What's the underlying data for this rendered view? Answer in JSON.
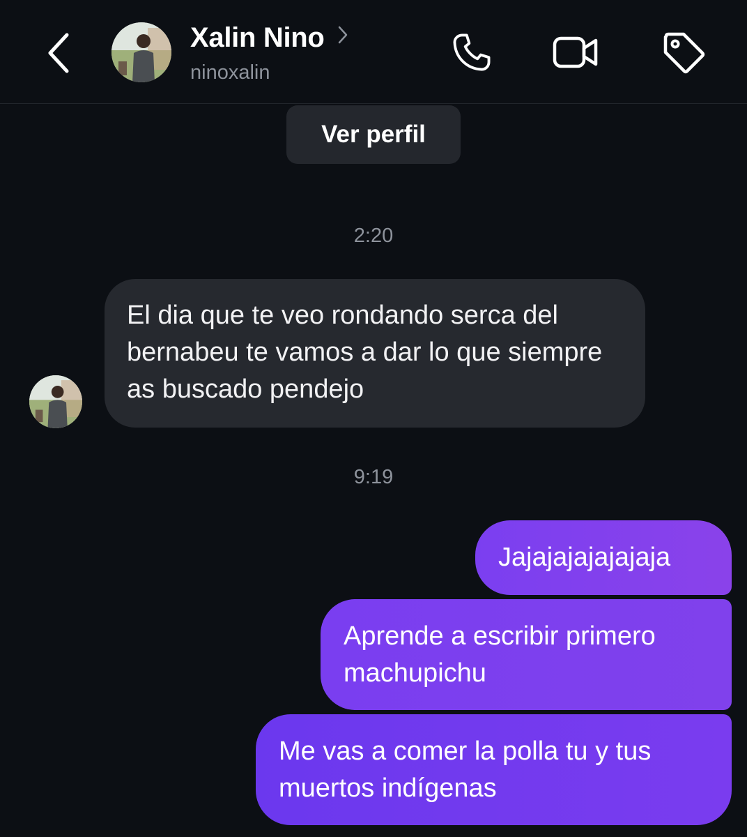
{
  "header": {
    "contact_name": "Xalin Nino",
    "username": "ninoxalin",
    "icons": [
      "back-chevron-icon",
      "chevron-right-icon",
      "phone-icon",
      "video-camera-icon",
      "tag-icon"
    ]
  },
  "profile_button": {
    "label": "Ver perfil"
  },
  "messages": [
    {
      "timestamp": "2:20"
    },
    {
      "direction": "incoming",
      "text": "El dia que te veo rondando serca del bernabeu te vamos a dar lo que siempre as buscado pendejo"
    },
    {
      "timestamp": "9:19"
    },
    {
      "direction": "outgoing",
      "text": "Jajajajajajajaja"
    },
    {
      "direction": "outgoing",
      "text": "Aprende a escribir primero machupichu"
    },
    {
      "direction": "outgoing",
      "text": "Me vas a comer la polla tu y tus muertos indígenas"
    }
  ],
  "colors": {
    "background": "#0c0f14",
    "incoming_bubble": "#26292f",
    "outgoing_bubble": "#7b3ff0",
    "secondary_text": "#8e939c"
  }
}
